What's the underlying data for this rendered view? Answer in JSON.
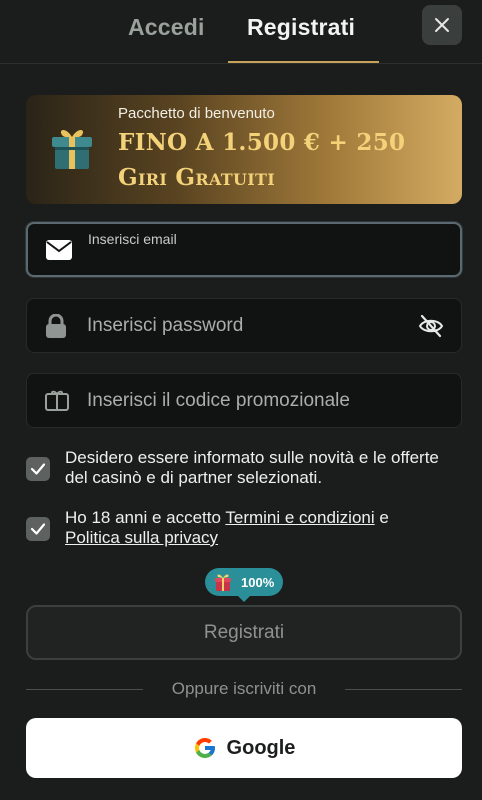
{
  "tabs": [
    {
      "label": "Accedi",
      "active": false
    },
    {
      "label": "Registrati",
      "active": true
    }
  ],
  "close_icon": "close-icon",
  "banner": {
    "subtitle": "Pacchetto di benvenuto",
    "title": "FINO A 1.500 € + 250 Giri Gratuiti",
    "icon": "gift-icon"
  },
  "form": {
    "email": {
      "label": "Inserisci email",
      "value": "",
      "icon": "mail-icon"
    },
    "password": {
      "placeholder": "Inserisci password",
      "icon": "lock-icon",
      "toggle_icon": "eye-off-icon"
    },
    "promo": {
      "placeholder": "Inserisci il codice promozionale",
      "icon": "ticket-icon"
    }
  },
  "checkboxes": {
    "marketing": {
      "checked": true,
      "text": "Desidero essere informato sulle novità e le offerte del casinò e di partner selezionati."
    },
    "terms": {
      "checked": true,
      "prefix": "Ho 18 anni e accetto ",
      "terms_link": "Termini e condizioni",
      "middle": " e",
      "privacy_link": "Politica sulla privacy"
    }
  },
  "progress_badge": {
    "icon": "gift-icon",
    "percent": "100%"
  },
  "submit_label": "Registrati",
  "divider_text": "Oppure iscriviti con",
  "google_label": "Google",
  "colors": {
    "background": "#1a1d1b",
    "accent_gold": "#c9a25a",
    "badge_teal": "#2a8f98"
  }
}
